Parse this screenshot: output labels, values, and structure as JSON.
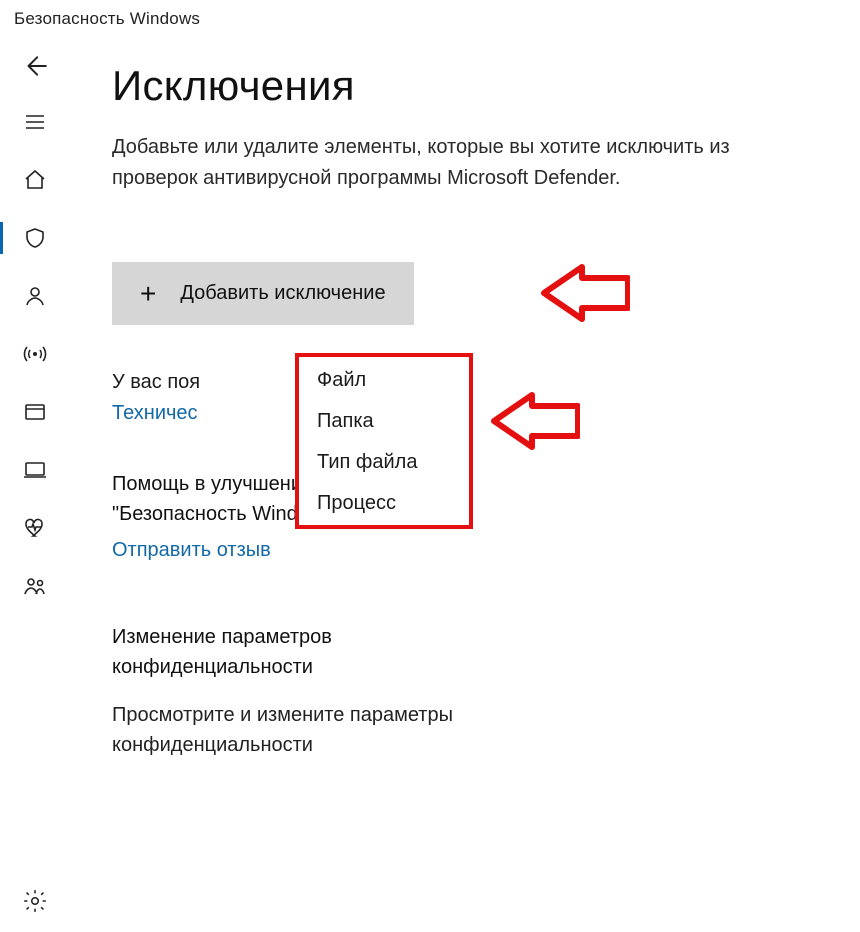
{
  "app_title": "Безопасность Windows",
  "page_title": "Исключения",
  "subtitle": "Добавьте или удалите элементы, которые вы хотите исключить из проверок антивирусной программы Microsoft Defender.",
  "add_button_label": "Добавить исключение",
  "dropdown": {
    "items": [
      "Файл",
      "Папка",
      "Тип файла",
      "Процесс"
    ]
  },
  "questions": {
    "title_partial_left": "У вас поя",
    "title_partial_right": "?",
    "link": "Техничес"
  },
  "help_block": {
    "title": "Помощь в улучшении службы \"Безопасность Windows\"",
    "link": "Отправить отзыв"
  },
  "privacy_block": {
    "title": "Изменение параметров конфиденциальности",
    "body": "Просмотрите и измените параметры конфиденциальности"
  }
}
